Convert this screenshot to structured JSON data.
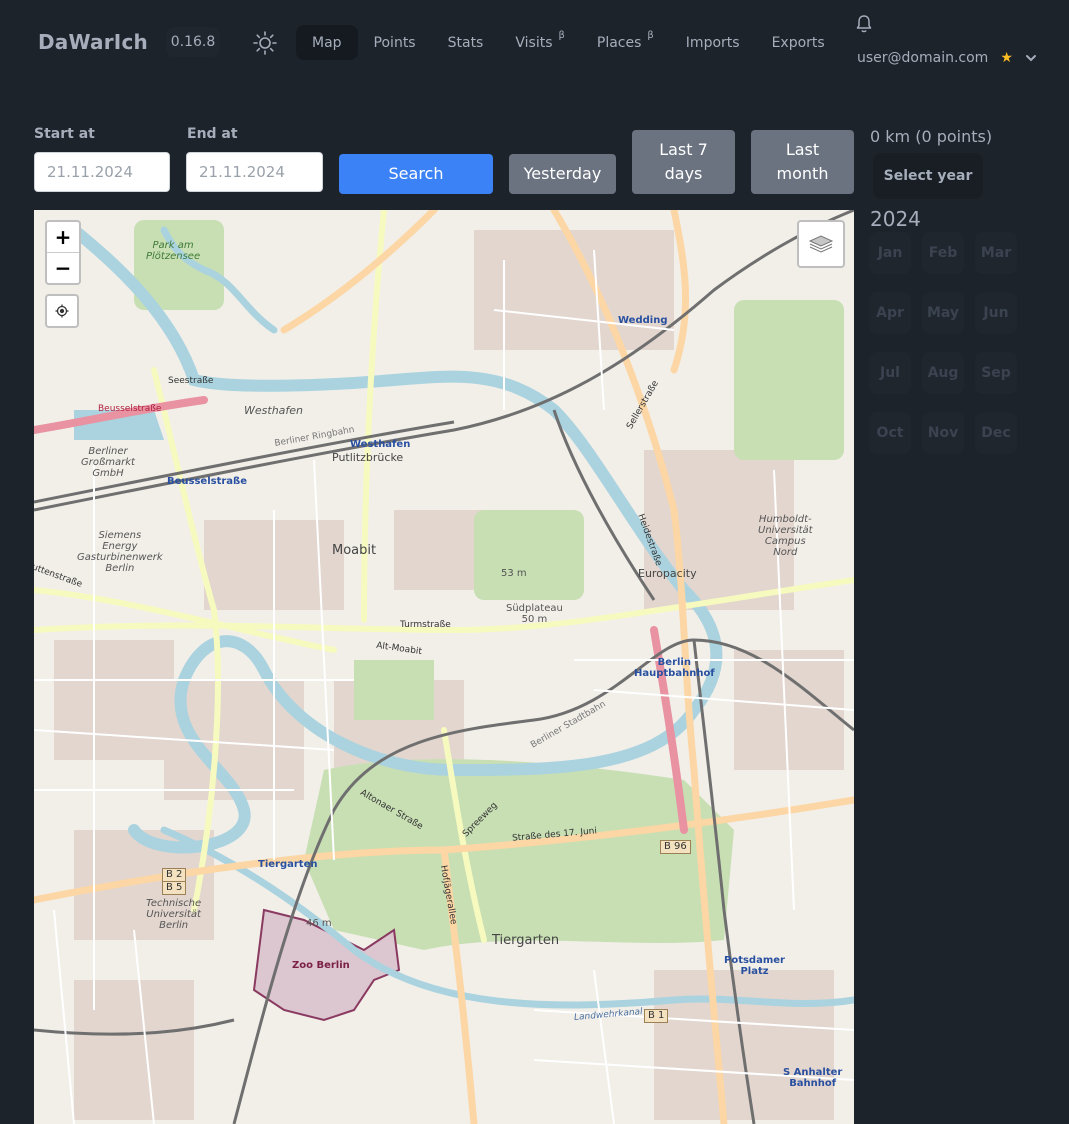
{
  "navbar": {
    "brand": "DaWarIch",
    "version": "0.16.8",
    "items": [
      {
        "label": "Map",
        "beta": ""
      },
      {
        "label": "Points",
        "beta": ""
      },
      {
        "label": "Stats",
        "beta": ""
      },
      {
        "label": "Visits",
        "beta": "β"
      },
      {
        "label": "Places",
        "beta": "β"
      },
      {
        "label": "Imports",
        "beta": ""
      },
      {
        "label": "Exports",
        "beta": ""
      }
    ],
    "user_email": "user@domain.com",
    "star": "★",
    "icons": {
      "theme": "sun-icon",
      "notifications": "bell-icon",
      "menu": "chevron-down-icon"
    }
  },
  "filters": {
    "start_label": "Start at",
    "start_value": "21.11.2024",
    "end_label": "End at",
    "end_value": "21.11.2024",
    "search_label": "Search",
    "yesterday_label": "Yesterday",
    "last7_line1": "Last 7",
    "last7_line2": "days",
    "lastmonth_line1": "Last",
    "lastmonth_line2": "month"
  },
  "sidebar": {
    "summary": "0 km (0 points)",
    "select_year": "Select year",
    "year": "2024",
    "months": [
      "Jan",
      "Feb",
      "Mar",
      "Apr",
      "May",
      "Jun",
      "Jul",
      "Aug",
      "Sep",
      "Oct",
      "Nov",
      "Dec"
    ]
  },
  "map": {
    "zoom_in": "+",
    "zoom_out": "−",
    "labels": {
      "moabit": "Moabit",
      "tiergarten": "Tiergarten",
      "putlitzbrucke": "Putlitzbrücke",
      "europacity": "Europacity",
      "westhafen_area": "Westhafen",
      "westhafen_station": "Westhafen",
      "wedding": "Wedding",
      "beusselstrasse_station": "Beusselstraße",
      "berlin_hbf_1": "Berlin",
      "berlin_hbf_2": "Hauptbahnhof",
      "tiergarten_station": "Tiergarten",
      "zoo": "Zoo Berlin",
      "potsdamer_1": "Potsdamer",
      "potsdamer_2": "Platz",
      "anhalter_1": "S Anhalter",
      "anhalter_2": "Bahnhof",
      "park_1": "Park am",
      "park_2": "Plötzensee",
      "grossmarkt_1": "Berliner",
      "grossmarkt_2": "Großmarkt",
      "grossmarkt_3": "GmbH",
      "siemens_1": "Siemens",
      "siemens_2": "Energy",
      "siemens_3": "Gasturbinenwerk",
      "siemens_4": "Berlin",
      "tu_1": "Technische",
      "tu_2": "Universität",
      "tu_3": "Berlin",
      "humboldt_1": "Humboldt-",
      "humboldt_2": "Universität",
      "humboldt_3": "Campus",
      "humboldt_4": "Nord",
      "elev_53": "53 m",
      "sudplateau_1": "Südplateau",
      "sudplateau_2": "50 m",
      "elev_46": "46 m",
      "turmstrasse": "Turmstraße",
      "alt_moabit": "Alt-Moabit",
      "strasse_17_juni": "Straße des 17. Juni",
      "seestrasse": "Seestraße",
      "heidestrasse": "Heidestraße",
      "sellerstrasse": "Sellerstraße",
      "hofjagerallee": "Hofjägerallee",
      "altonaer": "Altonaer Straße",
      "spreeweg": "Spreeweg",
      "berliner_ringbahn": "Berliner Ringbahn",
      "berliner_stadtbahn": "Berliner Stadtbahn",
      "landwehrkanal": "Landwehrkanal",
      "beusselstrasse_road": "Beusselstraße",
      "huttenstrasse": "Huttenstraße",
      "b96": "B 96",
      "b2": "B 2",
      "b5": "B 5",
      "b1": "B 1"
    }
  },
  "colors": {
    "background": "#1d232a",
    "text": "#a6adbb",
    "primary": "#3b82f6",
    "gray_button": "#6b7280",
    "active_nav": "#141a20",
    "star": "#fbbd23"
  }
}
